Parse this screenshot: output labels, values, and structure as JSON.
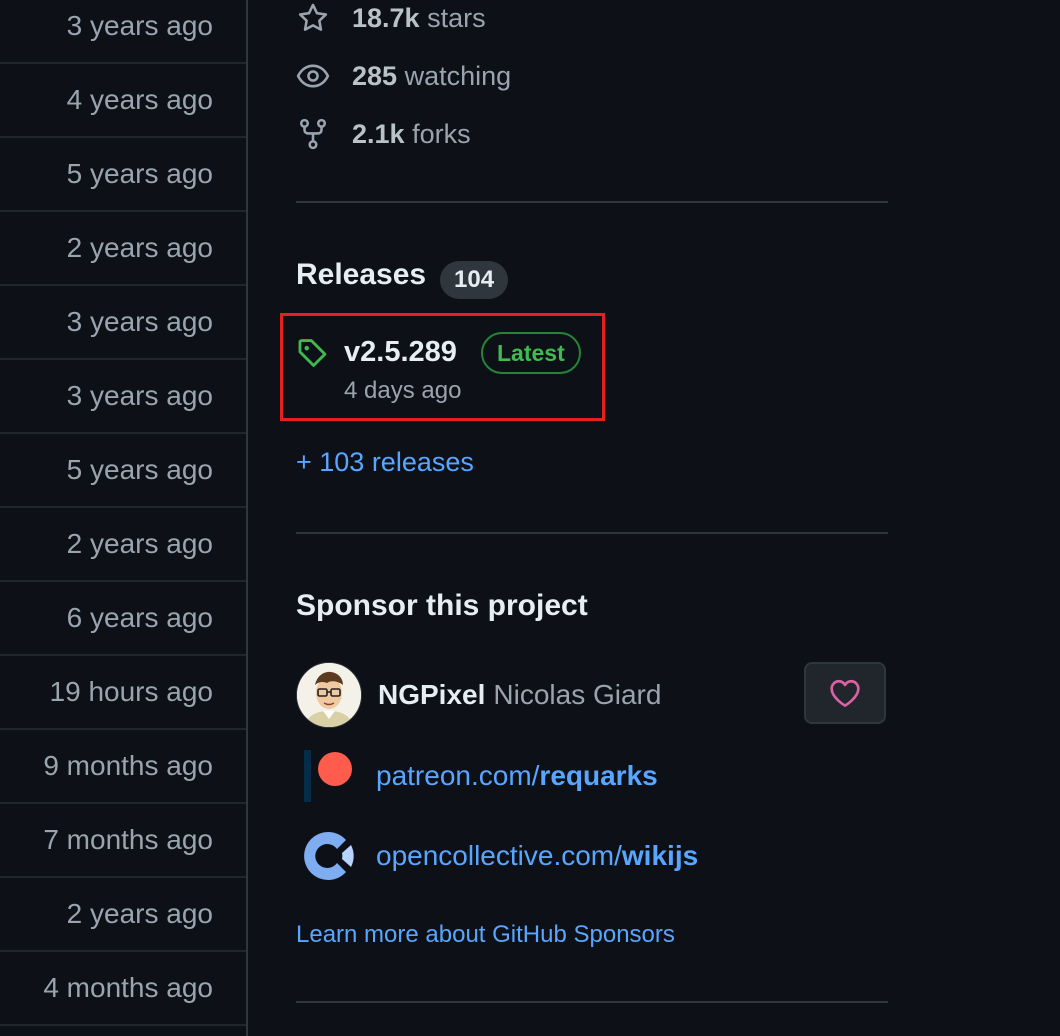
{
  "file_list": {
    "times": [
      "3 years ago",
      "4 years ago",
      "5 years ago",
      "2 years ago",
      "3 years ago",
      "3 years ago",
      "5 years ago",
      "2 years ago",
      "6 years ago",
      "19 hours ago",
      "9 months ago",
      "7 months ago",
      "2 years ago",
      "4 months ago"
    ]
  },
  "stats": {
    "stars": {
      "count": "18.7k",
      "label": "stars",
      "icon": "star-icon"
    },
    "watching": {
      "count": "285",
      "label": "watching",
      "icon": "eye-icon"
    },
    "forks": {
      "count": "2.1k",
      "label": "forks",
      "icon": "fork-icon"
    }
  },
  "releases": {
    "title": "Releases",
    "count": "104",
    "latest": {
      "name": "v2.5.289",
      "badge": "Latest",
      "date": "4 days ago",
      "icon": "tag-icon"
    },
    "more_link": "+ 103 releases"
  },
  "sponsor": {
    "title": "Sponsor this project",
    "login": "NGPixel",
    "full_name": "Nicolas Giard",
    "heart_icon": "heart-icon",
    "patreon": {
      "prefix": "patreon.com/",
      "handle": "requarks"
    },
    "opencollective": {
      "prefix": "opencollective.com/",
      "handle": "wikijs"
    },
    "learn_more": "Learn more about GitHub Sponsors"
  },
  "colors": {
    "background": "#0d1117",
    "link": "#58a6ff",
    "latest_green": "#3fb950",
    "highlight_box": "#e5211f",
    "heart_pink": "#db61a2",
    "patreon": "#ff5c4d",
    "opencollective": "#7fadf2"
  }
}
